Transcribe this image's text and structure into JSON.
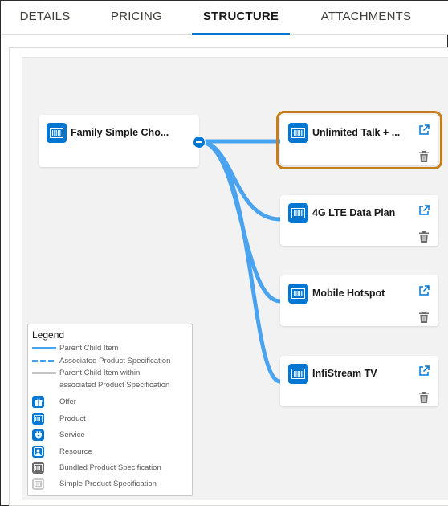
{
  "tabs": [
    {
      "label": "DETAILS"
    },
    {
      "label": "PRICING"
    },
    {
      "label": "STRUCTURE"
    },
    {
      "label": "ATTACHMENTS"
    }
  ],
  "root": {
    "label": "Family Simple Cho..."
  },
  "children": [
    {
      "label": "Unlimited Talk + ..."
    },
    {
      "label": "4G LTE Data Plan"
    },
    {
      "label": "Mobile Hotspot"
    },
    {
      "label": "InfiStream TV"
    }
  ],
  "legend": {
    "title": "Legend",
    "lines": [
      {
        "label": "Parent Child Item"
      },
      {
        "label": "Associated Product Specification"
      },
      {
        "label_line1": "Parent Child Item within",
        "label_line2": "associated Product Specification"
      }
    ],
    "icons": [
      {
        "label": "Offer"
      },
      {
        "label": "Product"
      },
      {
        "label": "Service"
      },
      {
        "label": "Resource"
      },
      {
        "label": "Bundled Product Specification"
      },
      {
        "label": "Simple Product Specification"
      }
    ]
  },
  "colors": {
    "accent": "#0176d3",
    "connector": "#4aa3ef",
    "selected_outline": "#c77d18",
    "bundled_icon": "#6b6b6b",
    "simple_icon": "#c9c9c9"
  }
}
